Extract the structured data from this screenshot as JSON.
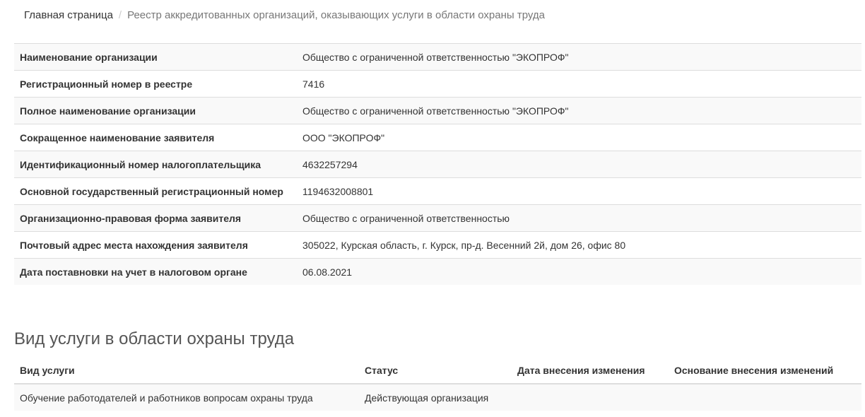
{
  "breadcrumb": {
    "home": "Главная страница",
    "separator": "/",
    "current": "Реестр аккредитованных организаций, оказывающих услуги в области охраны труда"
  },
  "details": [
    {
      "label": "Наименование организации",
      "value": "Общество с ограниченной ответственностью \"ЭКОПРОФ\""
    },
    {
      "label": "Регистрационный номер в реестре",
      "value": "7416"
    },
    {
      "label": "Полное наименование организации",
      "value": "Общество с ограниченной ответственностью \"ЭКОПРОФ\""
    },
    {
      "label": "Сокращенное наименование заявителя",
      "value": "ООО \"ЭКОПРОФ\""
    },
    {
      "label": "Идентификационный номер налогоплательщика",
      "value": "4632257294"
    },
    {
      "label": "Основной государственный регистрационный номер",
      "value": "1194632008801"
    },
    {
      "label": "Организационно-правовая форма заявителя",
      "value": "Общество с ограниченной ответственностью"
    },
    {
      "label": "Почтовый адрес места нахождения заявителя",
      "value": "305022, Курская область, г. Курск, пр-д. Весенний 2й, дом 26, офис 80"
    },
    {
      "label": "Дата поставновки на учет в налоговом органе",
      "value": "06.08.2021"
    }
  ],
  "services": {
    "title": "Вид услуги в области охраны труда",
    "headers": [
      "Вид услуги",
      "Статус",
      "Дата внесения изменения",
      "Основание внесения изменений"
    ],
    "rows": [
      [
        "Обучение работодателей и работников вопросам охраны труда",
        "Действующая организация",
        "",
        ""
      ]
    ]
  }
}
